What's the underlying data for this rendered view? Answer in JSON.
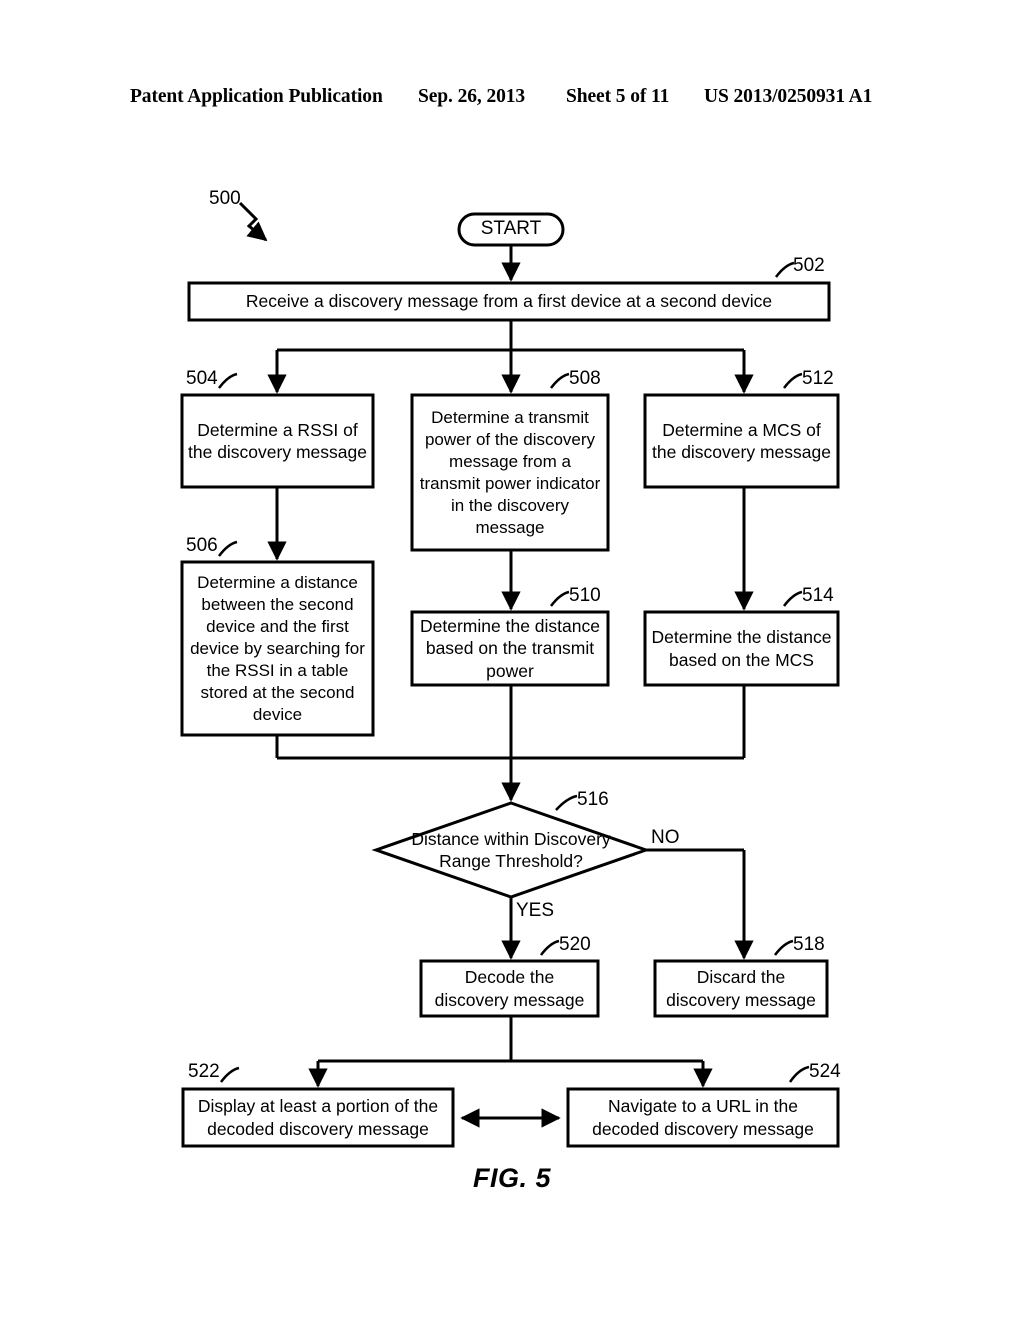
{
  "header": {
    "publication": "Patent Application Publication",
    "date": "Sep. 26, 2013",
    "sheet": "Sheet 5 of 11",
    "patent_number": "US 2013/0250931 A1"
  },
  "figure": {
    "caption": "FIG. 5",
    "diagram_ref": "500",
    "start_label": "START",
    "yes_label": "YES",
    "no_label": "NO",
    "nodes": [
      {
        "ref": "502",
        "text": "Receive a discovery message from a first device at a second device"
      },
      {
        "ref": "504",
        "text": "Determine a RSSI of the discovery message"
      },
      {
        "ref": "506",
        "text": "Determine a distance between the second device and the first device by searching for the RSSI in a table stored at the second device"
      },
      {
        "ref": "508",
        "text": "Determine a transmit power of the discovery message from a transmit power indicator in the discovery message"
      },
      {
        "ref": "510",
        "text": "Determine the distance based on the transmit power"
      },
      {
        "ref": "512",
        "text": "Determine a MCS of the discovery message"
      },
      {
        "ref": "514",
        "text": "Determine the distance based on the MCS"
      },
      {
        "ref": "516",
        "text": "Distance within Discovery Range Threshold?"
      },
      {
        "ref": "518",
        "text": "Discard the discovery message"
      },
      {
        "ref": "520",
        "text": "Decode the discovery message"
      },
      {
        "ref": "522",
        "text": "Display at least a portion of the decoded discovery message"
      },
      {
        "ref": "524",
        "text": "Navigate to a URL in the decoded discovery message"
      }
    ]
  },
  "colors": {
    "ink": "#000000",
    "paper": "#ffffff"
  }
}
